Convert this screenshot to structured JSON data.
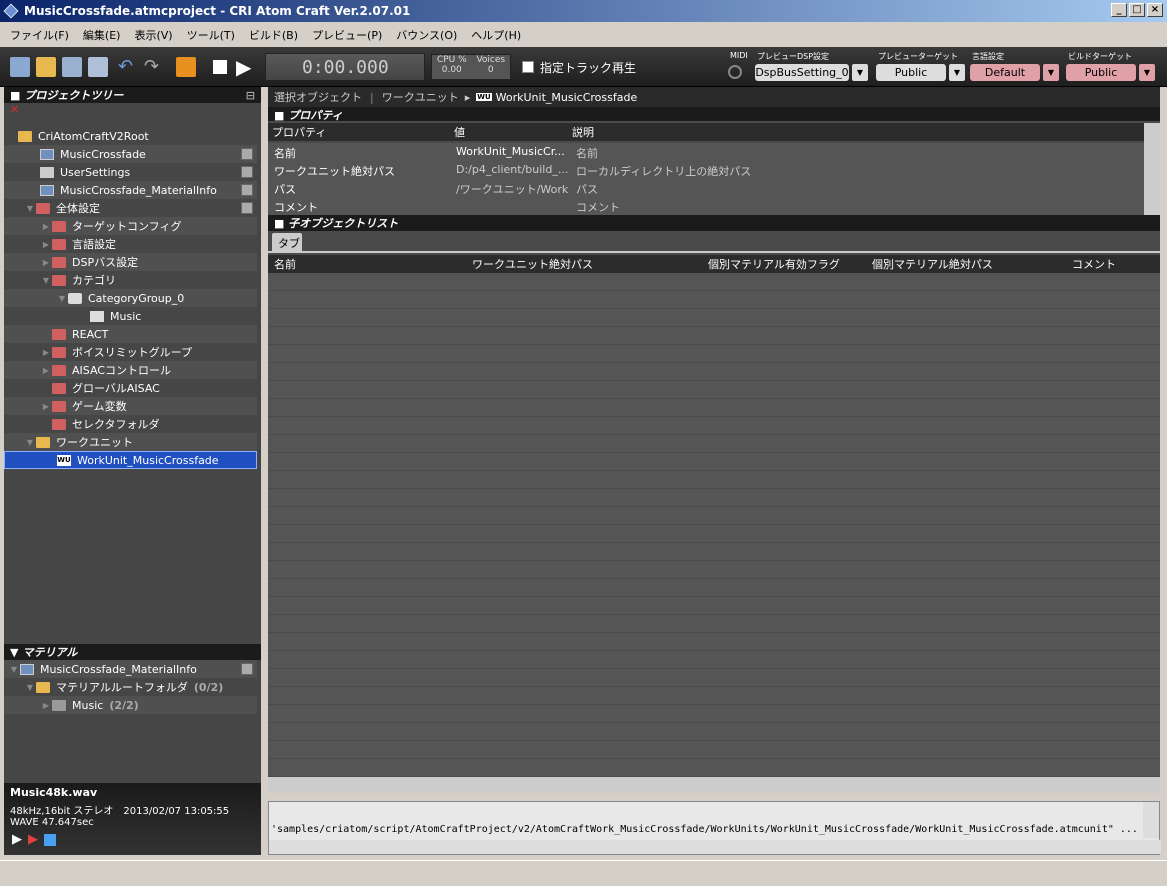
{
  "window": {
    "title": "MusicCrossfade.atmcproject - CRI Atom Craft Ver.2.07.01"
  },
  "menu": [
    "ファイル(F)",
    "編集(E)",
    "表示(V)",
    "ツール(T)",
    "ビルド(B)",
    "プレビュー(P)",
    "バウンス(O)",
    "ヘルプ(H)"
  ],
  "toolbar": {
    "time": "0:00.000",
    "cpu_label": "CPU %",
    "cpu_value": "0.00",
    "voices_label": "Voices",
    "voices_value": "0",
    "track_play_label": "指定トラック再生",
    "midi_label": "MIDI",
    "dsp_label": "プレビューDSP設定",
    "dsp_value": "DspBusSetting_0",
    "preview_target_label": "プレビューターゲット",
    "preview_target_value": "Public",
    "language_label": "言語設定",
    "language_value": "Default",
    "build_target_label": "ビルドターゲット",
    "build_target_value": "Public"
  },
  "project_tree": {
    "title": "プロジェクトツリー",
    "root": "CriAtomCraftV2Root",
    "items": [
      {
        "label": "MusicCrossfade"
      },
      {
        "label": "UserSettings"
      },
      {
        "label": "MusicCrossfade_MaterialInfo"
      },
      {
        "label": "全体設定"
      },
      {
        "label": "ターゲットコンフィグ"
      },
      {
        "label": "言語設定"
      },
      {
        "label": "DSPバス設定"
      },
      {
        "label": "カテゴリ"
      },
      {
        "label": "CategoryGroup_0"
      },
      {
        "label": "Music"
      },
      {
        "label": "REACT"
      },
      {
        "label": "ボイスリミットグループ"
      },
      {
        "label": "AISACコントロール"
      },
      {
        "label": "グローバルAISAC"
      },
      {
        "label": "ゲーム変数"
      },
      {
        "label": "セレクタフォルダ"
      },
      {
        "label": "ワークユニット"
      },
      {
        "label": "WorkUnit_MusicCrossfade"
      }
    ]
  },
  "material": {
    "title": "マテリアル",
    "info": "MusicCrossfade_MaterialInfo",
    "root_folder": "マテリアルルートフォルダ",
    "root_count": "(0/2)",
    "music_folder": "Music",
    "music_count": "(2/2)"
  },
  "status": {
    "file": "Music48k.wav",
    "line1": "48kHz,16bit ステレオ　2013/02/07 13:05:55",
    "line2": "WAVE 47.647sec"
  },
  "breadcrumb": {
    "selected": "選択オブジェクト",
    "workunit": "ワークユニット",
    "wu_icon": "WU",
    "current": "WorkUnit_MusicCrossfade"
  },
  "properties": {
    "title": "プロパティ",
    "headers": [
      "プロパティ",
      "値",
      "説明"
    ],
    "rows": [
      {
        "name": "名前",
        "value": "WorkUnit_MusicCr...",
        "desc": "名前"
      },
      {
        "name": "ワークユニット絶対パス",
        "value": "D:/p4_client/build_...",
        "desc": "ローカルディレクトリ上の絶対パス"
      },
      {
        "name": "パス",
        "value": "/ワークユニット/WorkU...",
        "desc": "パス"
      },
      {
        "name": "コメント",
        "value": "",
        "desc": "コメント"
      }
    ]
  },
  "children": {
    "title": "子オブジェクトリスト",
    "tab": "タブ",
    "headers": [
      "名前",
      "ワークユニット絶対パス",
      "個別マテリアル有効フラグ",
      "個別マテリアル絶対パス",
      "コメント"
    ]
  },
  "output": {
    "path": "'samples/criatom/script/AtomCraftProject/v2/AtomCraftWork_MusicCrossfade/WorkUnits/WorkUnit_MusicCrossfade/WorkUnit_MusicCrossfade.atmcunit\" ..."
  }
}
